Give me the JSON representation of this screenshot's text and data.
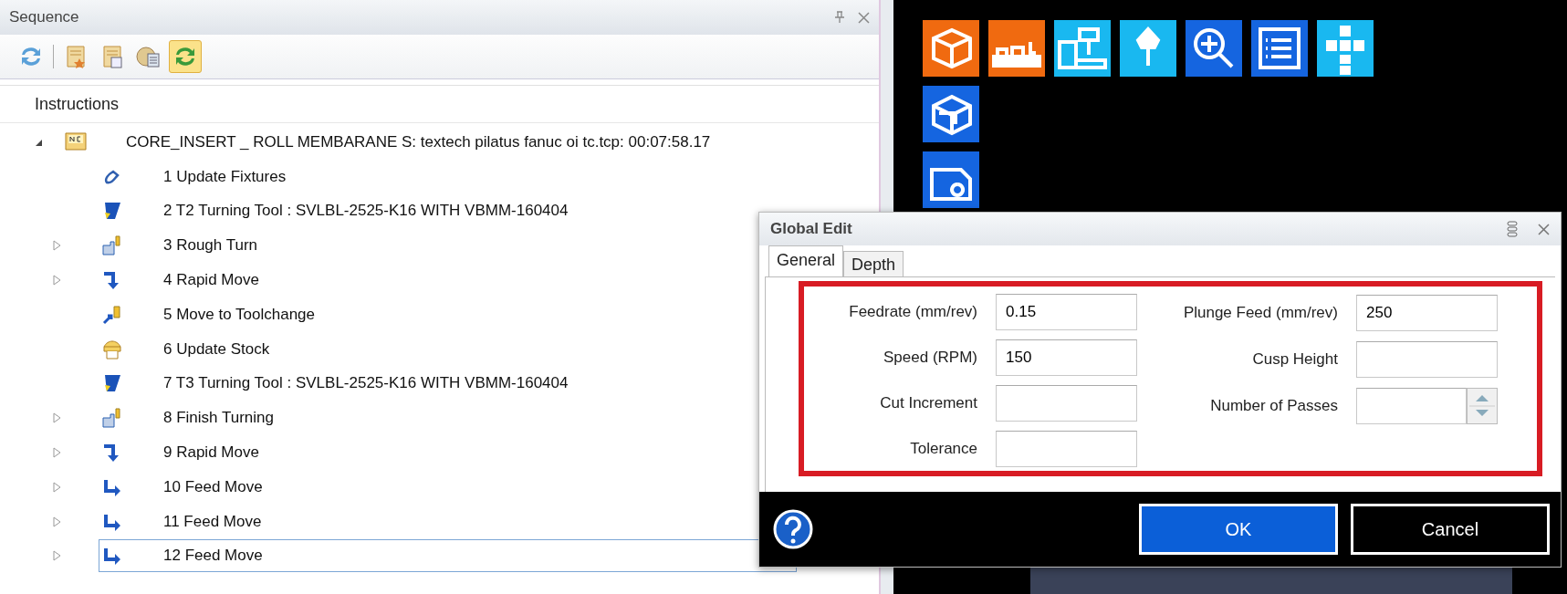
{
  "sequence_panel": {
    "title": "Sequence",
    "toolbar": [
      {
        "kind": "refresh",
        "selected": false
      },
      {
        "kind": "scroll-star",
        "selected": false
      },
      {
        "kind": "scroll-list",
        "selected": false
      },
      {
        "kind": "globe-list",
        "selected": false
      },
      {
        "kind": "cycle",
        "selected": true
      }
    ],
    "header": "Instructions",
    "tree": {
      "label": "CORE_INSERT _ ROLL MEMBARANE S: textech pilatus fanuc oi tc.tcp: 00:07:58.17",
      "expanded": true,
      "selected": false,
      "children": [
        {
          "label": "1 Update Fixtures",
          "kind": "fixture",
          "expandable": false,
          "selected": false
        },
        {
          "label": "2 T2 Turning Tool : SVLBL-2525-K16 WITH VBMM-160404",
          "kind": "tool",
          "expandable": false,
          "selected": false
        },
        {
          "label": "3 Rough Turn",
          "kind": "rough",
          "expandable": true,
          "selected": false
        },
        {
          "label": "4 Rapid Move",
          "kind": "rapid",
          "expandable": true,
          "selected": false
        },
        {
          "label": "5 Move to Toolchange",
          "kind": "toolchange",
          "expandable": false,
          "selected": false
        },
        {
          "label": "6 Update Stock",
          "kind": "stock",
          "expandable": false,
          "selected": false
        },
        {
          "label": "7 T3 Turning Tool : SVLBL-2525-K16 WITH VBMM-160404",
          "kind": "tool",
          "expandable": false,
          "selected": false
        },
        {
          "label": "8 Finish Turning",
          "kind": "finish",
          "expandable": true,
          "selected": false
        },
        {
          "label": "9 Rapid Move",
          "kind": "rapid",
          "expandable": true,
          "selected": false
        },
        {
          "label": "10 Feed Move",
          "kind": "feed",
          "expandable": true,
          "selected": false
        },
        {
          "label": "11 Feed Move",
          "kind": "feed",
          "expandable": true,
          "selected": false
        },
        {
          "label": "12 Feed Move",
          "kind": "feed",
          "expandable": true,
          "selected": true
        }
      ]
    }
  },
  "viewport": {
    "tiles": [
      {
        "kind": "cube",
        "color": "#f06a10"
      },
      {
        "kind": "table",
        "color": "#f06a10"
      },
      {
        "kind": "machine",
        "color": "#19b8f0"
      },
      {
        "kind": "spindle",
        "color": "#19b8f0"
      },
      {
        "kind": "zoom",
        "color": "#1565e0"
      },
      {
        "kind": "list",
        "color": "#1565e0"
      },
      {
        "kind": "views",
        "color": "#19b8f0"
      }
    ],
    "side_tiles": [
      {
        "kind": "box",
        "color": "#1565e0"
      },
      {
        "kind": "block",
        "color": "#1565e0"
      }
    ]
  },
  "dialog": {
    "title": "Global Edit",
    "tabs": [
      {
        "label": "General",
        "selected": true
      },
      {
        "label": "Depth",
        "selected": false
      }
    ],
    "left_fields": [
      {
        "label": "Feedrate (mm/rev)",
        "value": "0.15"
      },
      {
        "label": "Speed (RPM)",
        "value": "150"
      },
      {
        "label": "Cut Increment"
      },
      {
        "label": "Tolerance"
      }
    ],
    "right_fields": [
      {
        "label": "Plunge Feed (mm/rev)",
        "value": "250",
        "kind": "text"
      },
      {
        "label": "Cusp Height",
        "kind": "text"
      },
      {
        "label": "Number of Passes",
        "kind": "spinner"
      }
    ],
    "buttons": [
      {
        "label": "OK",
        "kind": "primary"
      },
      {
        "label": "Cancel",
        "kind": "secondary"
      }
    ]
  }
}
